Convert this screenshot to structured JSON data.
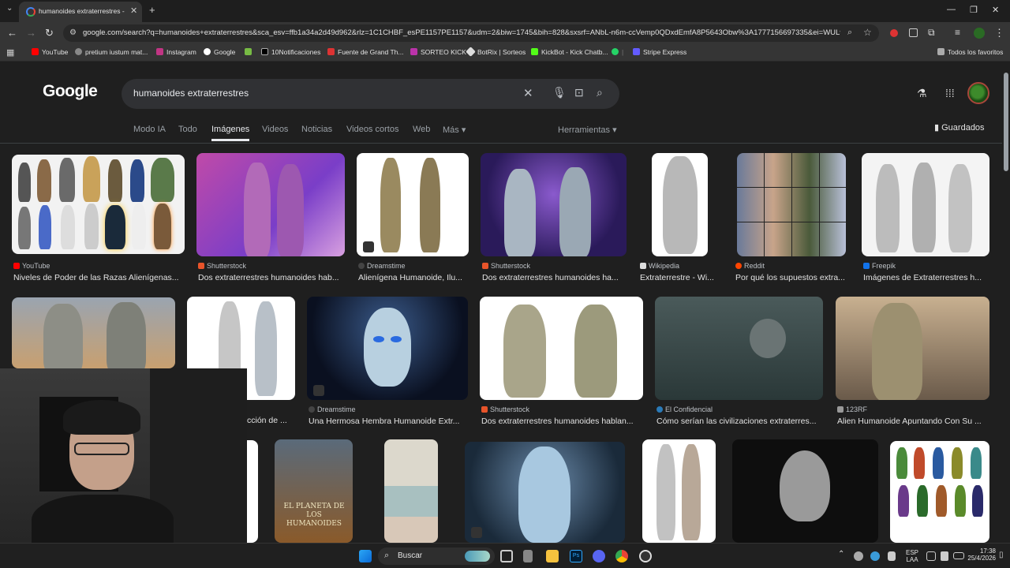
{
  "browser": {
    "tab_title": "humanoides extraterrestres - Bú",
    "url": "google.com/search?q=humanoides+extraterrestres&sca_esv=ffb1a34a2d49d962&rlz=1C1CHBF_esPE1157PE1157&udm=2&biw=1745&bih=828&sxsrf=ANbL-n6m-ccVemp0QDxdEmfA8P5643Obw%3A1777156697335&ei=WULtaey...",
    "bookmarks": [
      "YouTube",
      "pretium iustum mat...",
      "Instagram",
      "Google",
      "10Notificaciones",
      "Fuente de Grand Th...",
      "SORTEO KICK",
      "BotRix | Sorteos",
      "KickBot - Kick Chatb...",
      "Stripe Express"
    ],
    "all_bookmarks": "Todos los favoritos"
  },
  "google": {
    "logo": "Google",
    "query": "humanoides extraterrestres",
    "tabs": [
      "Modo IA",
      "Todo",
      "Imágenes",
      "Videos",
      "Noticias",
      "Videos cortos",
      "Web",
      "Más"
    ],
    "tools": "Herramientas",
    "saved": "Guardados"
  },
  "results_row1": [
    {
      "source": "YouTube",
      "title": "Niveles de Poder de las Razas Alienígenas..."
    },
    {
      "source": "Shutterstock",
      "title": "Dos extraterrestres humanoides hab..."
    },
    {
      "source": "Dreamstime",
      "title": "Alienígena Humanoide, Ilu..."
    },
    {
      "source": "Shutterstock",
      "title": "Dos extraterrestres humanoides ha..."
    },
    {
      "source": "Wikipedia",
      "title": "Extraterrestre - Wi..."
    },
    {
      "source": "Reddit",
      "title": "Por qué los supuestos extra..."
    },
    {
      "source": "Freepik",
      "title": "Imágenes de Extraterrestres h..."
    }
  ],
  "results_row2": [
    {
      "source": "",
      "title": "cción de ..."
    },
    {
      "source": "Dreamstime",
      "title": "Una Hermosa Hembra Humanoide Extr..."
    },
    {
      "source": "Shutterstock",
      "title": "Dos extraterrestres humanoides hablan..."
    },
    {
      "source": "El Confidencial",
      "title": "Cómo serían las civilizaciones extraterres..."
    },
    {
      "source": "123RF",
      "title": "Alien Humanoide Apuntando Con Su ..."
    }
  ],
  "book_cover": "EL PLANETA DE LOS HUMANOIDES",
  "taskbar": {
    "search": "Buscar",
    "lang": "ESP",
    "region": "LAA",
    "time": "17:38",
    "date": "25/4/2026"
  },
  "colors": {
    "background": "#1f1f1f",
    "searchbox": "#303134",
    "text": "#e3e3e3"
  }
}
